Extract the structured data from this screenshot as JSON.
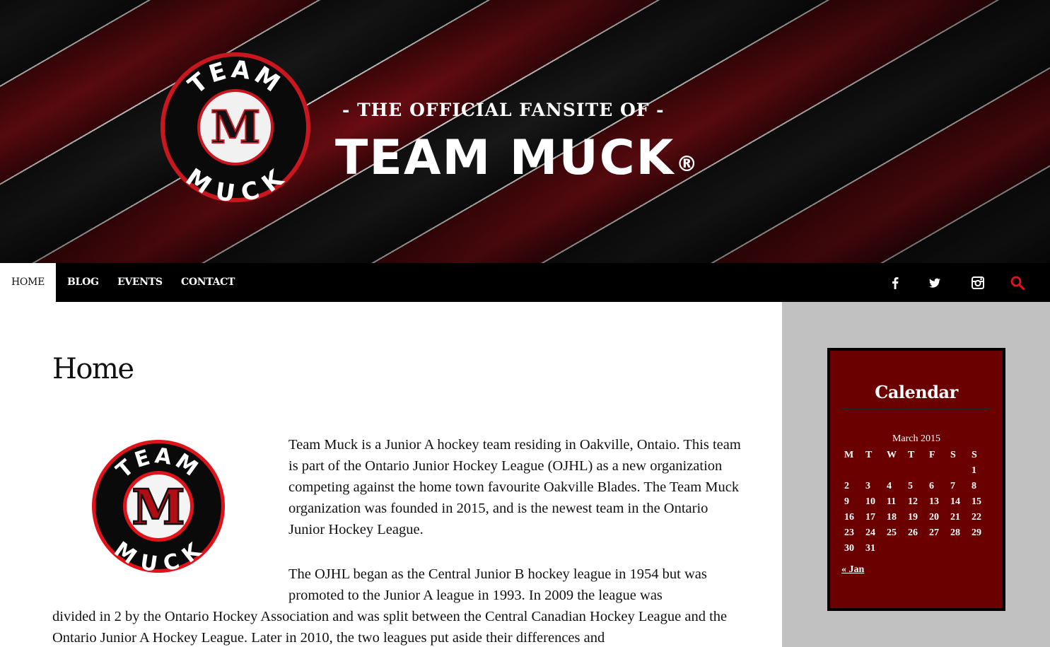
{
  "header": {
    "tagline": "- THE OFFICIAL FANSITE OF -",
    "brand": "TEAM MUCK",
    "registered_mark": "®",
    "logo": {
      "top_text": "TEAM",
      "bottom_text": "MUCK",
      "letter": "M"
    }
  },
  "nav": {
    "items": [
      {
        "label": "HOME",
        "active": true
      },
      {
        "label": "BLOG",
        "active": false
      },
      {
        "label": "EVENTS",
        "active": false
      },
      {
        "label": "CONTACT",
        "active": false
      }
    ],
    "icons": [
      "facebook-icon",
      "twitter-icon",
      "instagram-icon",
      "search-icon"
    ],
    "search_icon_color": "#e0131b"
  },
  "main": {
    "title": "Home",
    "paragraph1": "Team Muck is a Junior A hockey team residing in Oakville, Ontaio. This team is part of the Ontario Junior Hockey League (OJHL) as a new organization competing against the home town favourite Oakville Blades. The Team Muck organization was founded in 2015, and is the newest team in the Ontario Junior Hockey League.",
    "paragraph2_part1": "The OJHL began as the Central Junior B hockey league in 1954 but was promoted to the Junior A league in 1993. In 2009 the league was",
    "paragraph2_part2": "divided in 2 by the Ontario Hockey Association and was split between the Central Canadian Hockey League and the Ontario Junior A Hockey League. Later in 2010, the two leagues put aside their differences and"
  },
  "sidebar": {
    "calendar": {
      "title": "Calendar",
      "caption": "March 2015",
      "weekdays": [
        "M",
        "T",
        "W",
        "T",
        "F",
        "S",
        "S"
      ],
      "weeks": [
        [
          "",
          "",
          "",
          "",
          "",
          "",
          "1"
        ],
        [
          "2",
          "3",
          "4",
          "5",
          "6",
          "7",
          "8"
        ],
        [
          "9",
          "10",
          "11",
          "12",
          "13",
          "14",
          "15"
        ],
        [
          "16",
          "17",
          "18",
          "19",
          "20",
          "21",
          "22"
        ],
        [
          "23",
          "24",
          "25",
          "26",
          "27",
          "28",
          "29"
        ],
        [
          "30",
          "31",
          "",
          "",
          "",
          "",
          ""
        ]
      ],
      "prev_link": "« Jan"
    }
  },
  "colors": {
    "nav_bg": "#000000",
    "sidebar_bg": "#c1c1c1",
    "calendar_bg": "#6b0000",
    "brand_red": "#c8171e"
  }
}
